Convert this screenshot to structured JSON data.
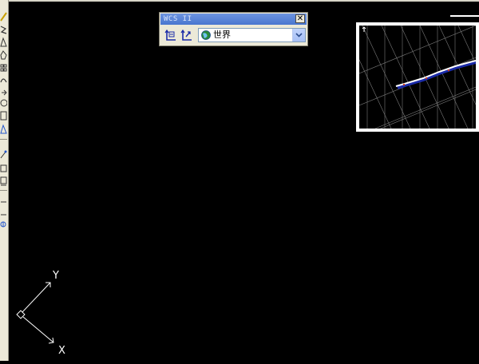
{
  "wcs_toolbar": {
    "title": "WCS II",
    "close_glyph": "✕",
    "buttons": [
      {
        "name": "ucs-manager-icon"
      },
      {
        "name": "ucs-previous-icon"
      }
    ],
    "dropdown": {
      "selected_value": "世界",
      "icon": "globe-icon"
    }
  },
  "ucs_icon": {
    "y_label": "Y",
    "x_label": "X"
  },
  "left_toolbar": {
    "tools": [
      "line-icon",
      "polyline-icon",
      "triangle-icon",
      "polygon-icon",
      "rectangle-icon",
      "arc-icon",
      "circle-icon",
      "revision-cloud-icon",
      "spline-icon",
      "ellipse-icon",
      "ellipse-arc-icon",
      "insert-block-icon",
      "make-block-icon",
      "point-icon",
      "hatch-icon",
      "region-icon",
      "text-icon"
    ]
  },
  "colors": {
    "background": "#000000",
    "toolbar_face": "#ece9d8",
    "title_bar": "#4876cf",
    "viewport_border": "#ffffff",
    "linework": "#ffffff",
    "accent_blue": "#1a2aa8"
  }
}
